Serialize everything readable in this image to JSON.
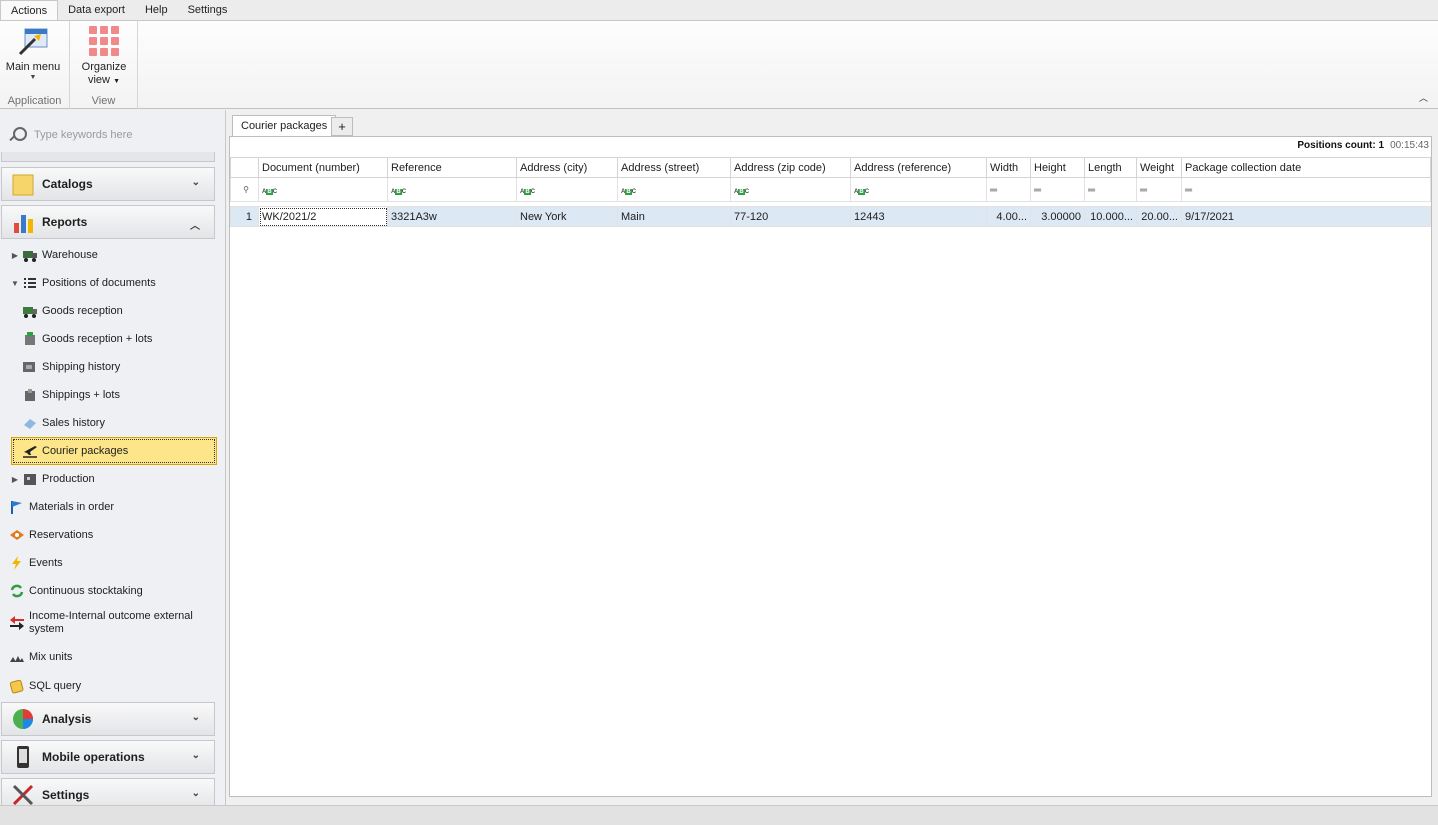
{
  "menu": {
    "tabs": [
      "Actions",
      "Data export",
      "Help",
      "Settings"
    ]
  },
  "ribbon": {
    "application_group": {
      "caption": "Application",
      "main_menu_label": "Main menu"
    },
    "view_group": {
      "caption": "View",
      "organize_label_1": "Organize",
      "organize_label_2": "view"
    }
  },
  "sidebar": {
    "search_placeholder": "Type keywords here",
    "sections": {
      "catalogs": "Catalogs",
      "reports": "Reports",
      "analysis": "Analysis",
      "mobile": "Mobile operations",
      "settings": "Settings"
    },
    "items": {
      "warehouse": "Warehouse",
      "positions": "Positions of documents",
      "goods_reception": "Goods reception",
      "goods_reception_lots": "Goods reception + lots",
      "shipping_history": "Shipping history",
      "shippings_lots": "Shippings + lots",
      "sales_history": "Sales history",
      "courier_packages": "Courier packages",
      "production": "Production",
      "materials": "Materials in order",
      "reservations": "Reservations",
      "events": "Events",
      "stocktaking": "Continuous stocktaking",
      "income_1": "Income-Internal outcome external",
      "income_2": "system",
      "mix_units": "Mix units",
      "sql_query": "SQL query"
    }
  },
  "document": {
    "tab_label": "Courier packages",
    "add_tab_label": "+",
    "positions_count": "Positions count: 1",
    "elapsed": "00:15:43",
    "columns": [
      "Document (number)",
      "Reference",
      "Address (city)",
      "Address (street)",
      "Address (zip code)",
      "Address (reference)",
      "Width",
      "Height",
      "Length",
      "Weight",
      "Package collection date"
    ],
    "rows": [
      {
        "num": "1",
        "document": "WK/2021/2",
        "reference": "3321A3w",
        "city": "New York",
        "street": "Main",
        "zip": "77-120",
        "addr_ref": "12443",
        "width": "4.00...",
        "height": "3.00000",
        "length": "10.000...",
        "weight": "20.00...",
        "date": "9/17/2021"
      }
    ]
  }
}
